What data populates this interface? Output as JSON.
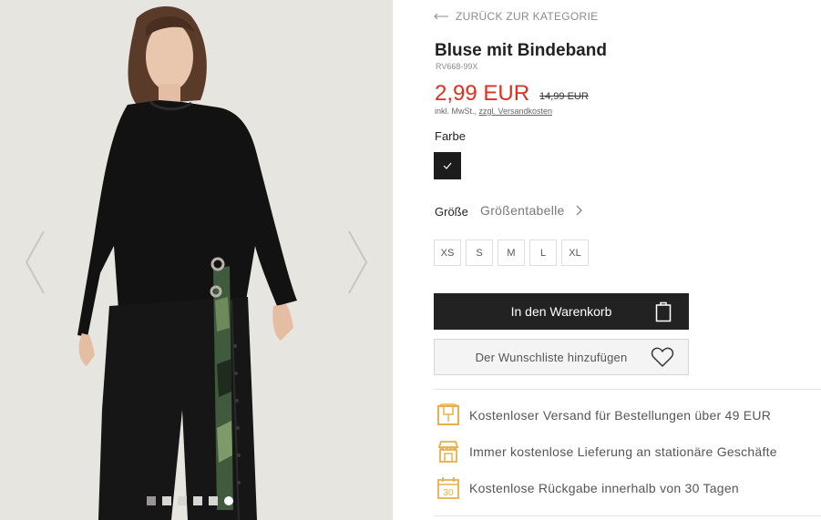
{
  "gallery": {
    "prev_icon": "chevron-left-icon",
    "next_icon": "chevron-right-icon",
    "image_description": "model wearing black blouse with camouflage tie belt",
    "dot_count": 6,
    "active_dot": 6
  },
  "product": {
    "back_label": "ZURÜCK ZUR KATEGORIE",
    "title": "Bluse mit Bindeband",
    "sku": "RV668-99X",
    "price": "2,99 EUR",
    "old_price": "14,99 EUR",
    "tax_prefix": "inkl. MwSt., ",
    "shipping_link": "zzgl. Versandkosten",
    "color_label": "Farbe",
    "selected_color": "#1c1c1c",
    "size_label": "Größe",
    "size_chart_label": "Größentabelle",
    "sizes": [
      "XS",
      "S",
      "M",
      "L",
      "XL"
    ],
    "add_to_cart": "In den Warenkorb",
    "add_to_wishlist": "Der Wunschliste hinzufügen"
  },
  "benefits": [
    {
      "icon": "package-icon",
      "text": "Kostenloser Versand für Bestellungen über 49 EUR"
    },
    {
      "icon": "store-icon",
      "text": "Immer kostenlose Lieferung an stationäre Geschäfte"
    },
    {
      "icon": "calendar-30-icon",
      "text": "Kostenlose Rückgabe innerhalb von 30 Tagen"
    }
  ],
  "colors": {
    "accent": "#e8b04a",
    "price_red": "#e32d1e",
    "button_dark": "#222222"
  }
}
